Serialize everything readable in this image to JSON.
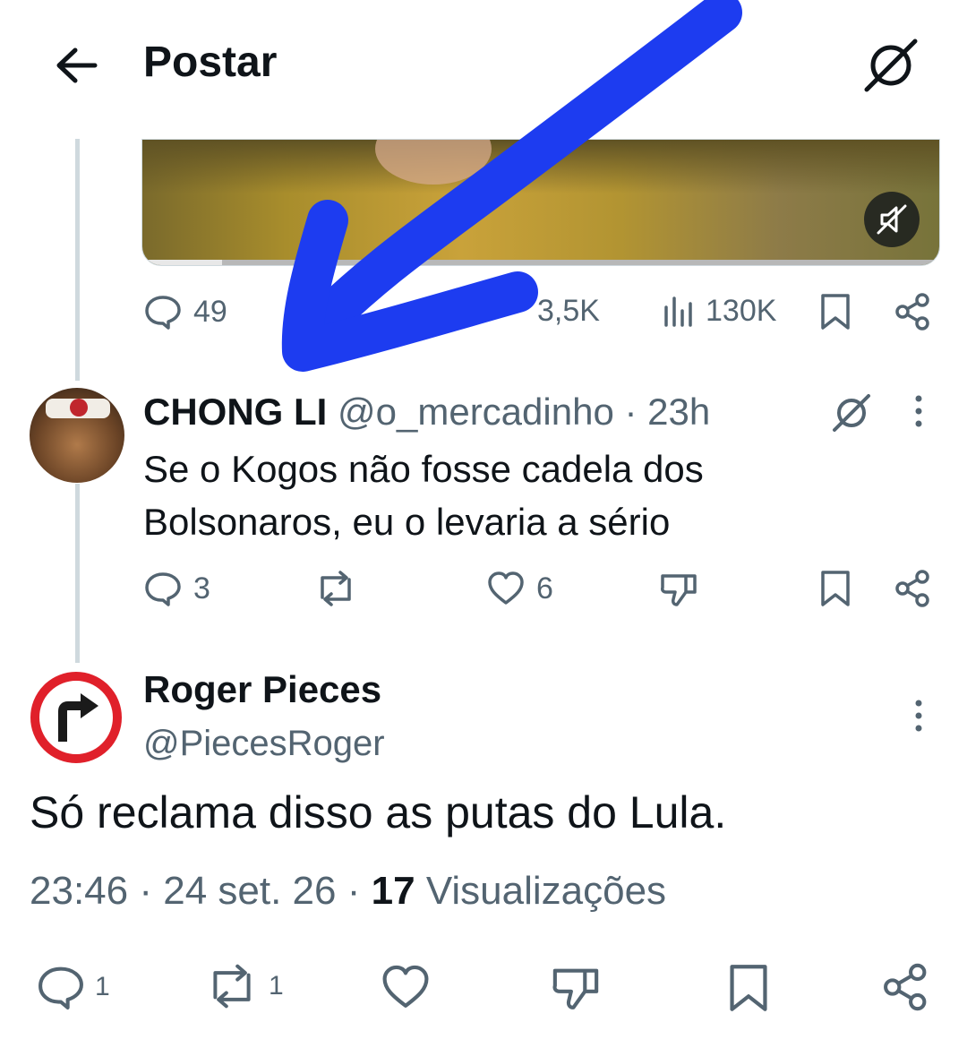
{
  "header": {
    "title": "Postar",
    "back_icon": "arrow-left-icon",
    "grok_icon": "grok-icon"
  },
  "parent_post": {
    "media_icon": "mute-icon",
    "stats": {
      "replies": "49",
      "likes": "3,5K",
      "views": "130K"
    }
  },
  "reply1": {
    "name": "CHONG LI",
    "handle": "@o_mercadinho",
    "separator": "·",
    "time": "23h",
    "text_line1": "Se o Kogos não fosse cadela dos",
    "text_line2": "Bolsonaros, eu o levaria a sério",
    "stats": {
      "replies": "3",
      "likes": "6"
    }
  },
  "main_post": {
    "name": "Roger Pieces",
    "handle": "@PiecesRoger",
    "text": "Só reclama disso as putas do Lula.",
    "time": "23:46",
    "date": "24 set. 26",
    "views_count": "17",
    "views_label": "Visualizações",
    "dot": "·",
    "stats": {
      "replies": "1",
      "reposts": "1"
    }
  },
  "colors": {
    "text": "#0f1419",
    "secondary": "#536471",
    "thread_line": "#cfd9de",
    "annotation_arrow": "#1d3cf0",
    "sign_red": "#e0202a"
  }
}
